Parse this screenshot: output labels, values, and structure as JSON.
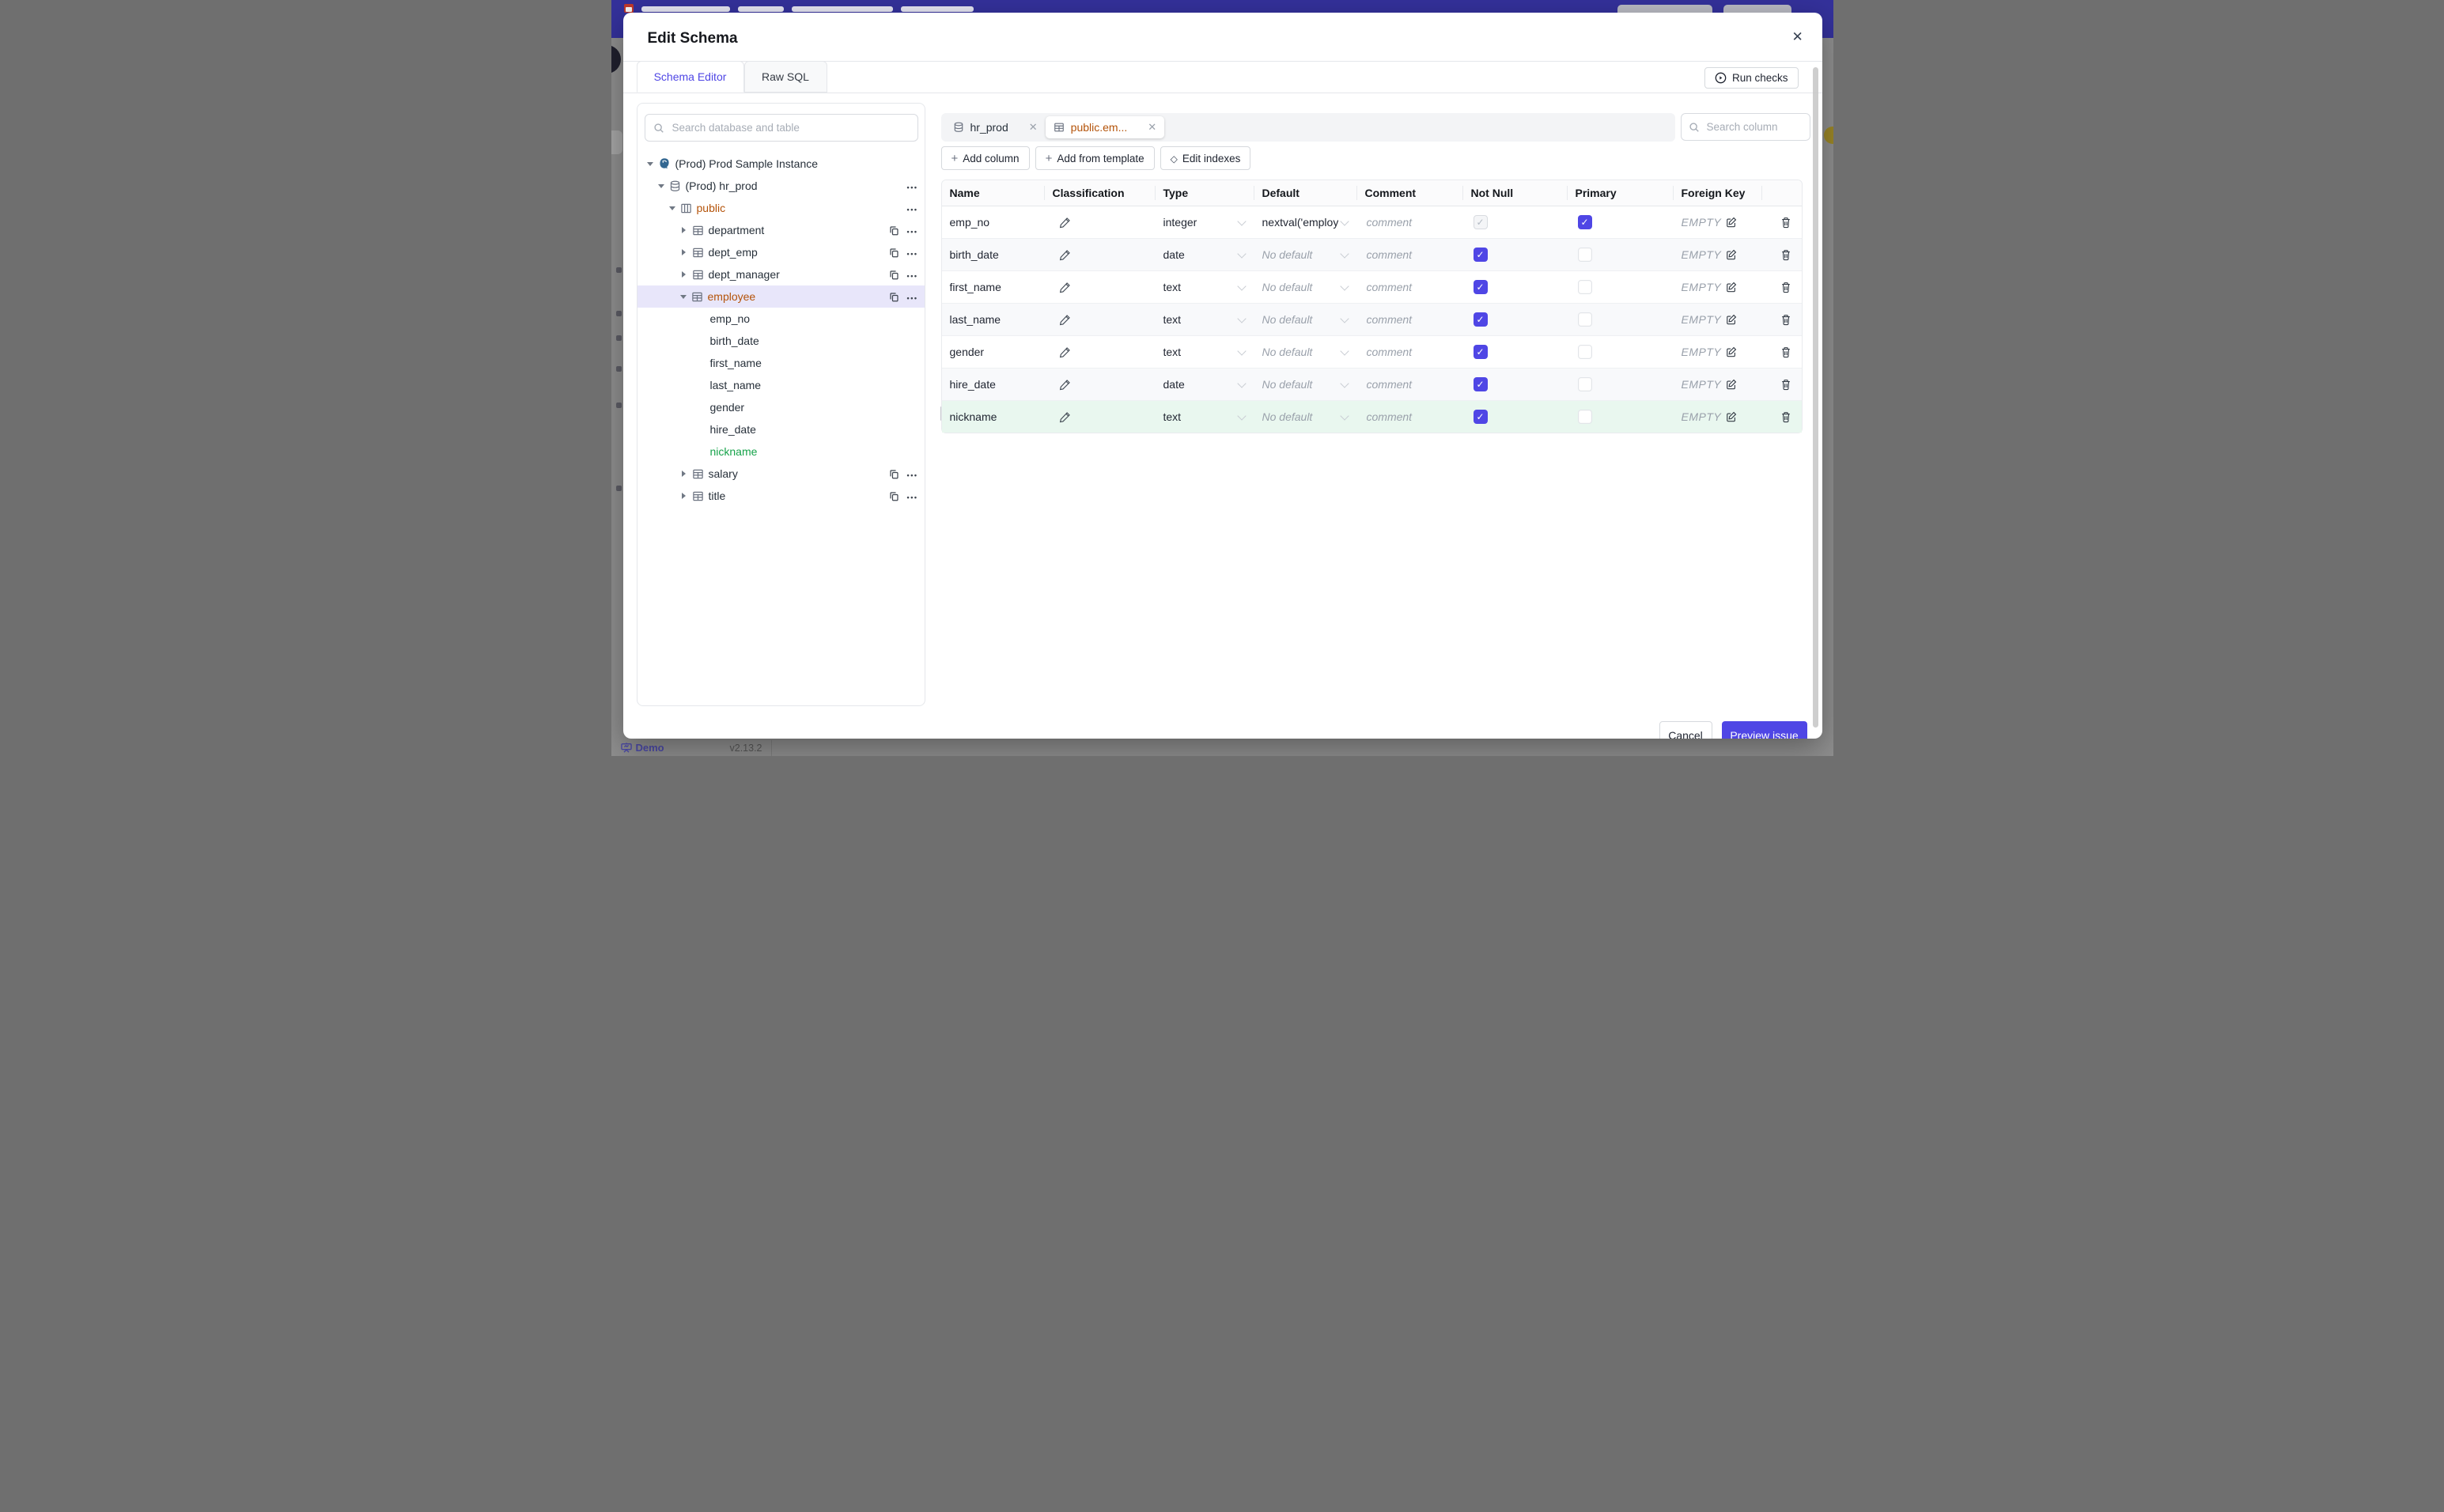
{
  "app": {
    "demo_label": "Demo",
    "version": "v2.13.2"
  },
  "modal": {
    "title": "Edit Schema",
    "tabs": [
      {
        "label": "Schema Editor"
      },
      {
        "label": "Raw SQL"
      }
    ],
    "run_checks_label": "Run checks",
    "cancel_label": "Cancel",
    "preview_label": "Preview issue"
  },
  "sidebar": {
    "search_placeholder": "Search database and table",
    "tree": [
      {
        "label": "(Prod) Prod Sample Instance"
      },
      {
        "label": "(Prod) hr_prod"
      },
      {
        "label": "public"
      },
      {
        "label": "department"
      },
      {
        "label": "dept_emp"
      },
      {
        "label": "dept_manager"
      },
      {
        "label": "employee"
      },
      {
        "label": "emp_no"
      },
      {
        "label": "birth_date"
      },
      {
        "label": "first_name"
      },
      {
        "label": "last_name"
      },
      {
        "label": "gender"
      },
      {
        "label": "hire_date"
      },
      {
        "label": "nickname"
      },
      {
        "label": "salary"
      },
      {
        "label": "title"
      }
    ]
  },
  "editor": {
    "chips": [
      {
        "label": "hr_prod"
      },
      {
        "label": "public.em..."
      }
    ],
    "column_search_placeholder": "Search column",
    "toolbar": {
      "add_column": "Add column",
      "add_from_template": "Add from template",
      "edit_indexes": "Edit indexes"
    },
    "table": {
      "headers": [
        "Name",
        "Classification",
        "Type",
        "Default",
        "Comment",
        "Not Null",
        "Primary",
        "Foreign Key"
      ],
      "comment_placeholder": "comment",
      "fk_empty": "EMPTY",
      "rows": [
        {
          "name": "emp_no",
          "type": "integer",
          "default": "nextval('employ",
          "not_null": true,
          "not_null_disabled": true,
          "primary": true,
          "new": false
        },
        {
          "name": "birth_date",
          "type": "date",
          "default": "No default",
          "not_null": true,
          "not_null_disabled": false,
          "primary": false,
          "new": false
        },
        {
          "name": "first_name",
          "type": "text",
          "default": "No default",
          "not_null": true,
          "not_null_disabled": false,
          "primary": false,
          "new": false
        },
        {
          "name": "last_name",
          "type": "text",
          "default": "No default",
          "not_null": true,
          "not_null_disabled": false,
          "primary": false,
          "new": false
        },
        {
          "name": "gender",
          "type": "text",
          "default": "No default",
          "not_null": true,
          "not_null_disabled": false,
          "primary": false,
          "new": false
        },
        {
          "name": "hire_date",
          "type": "date",
          "default": "No default",
          "not_null": true,
          "not_null_disabled": false,
          "primary": false,
          "new": false
        },
        {
          "name": "nickname",
          "type": "text",
          "default": "No default",
          "not_null": true,
          "not_null_disabled": false,
          "primary": false,
          "new": true
        }
      ]
    }
  },
  "colors": {
    "accent": "#4f46e5",
    "amber": "#b45309",
    "green": "#16a34a",
    "header_bg": "#34319b"
  }
}
